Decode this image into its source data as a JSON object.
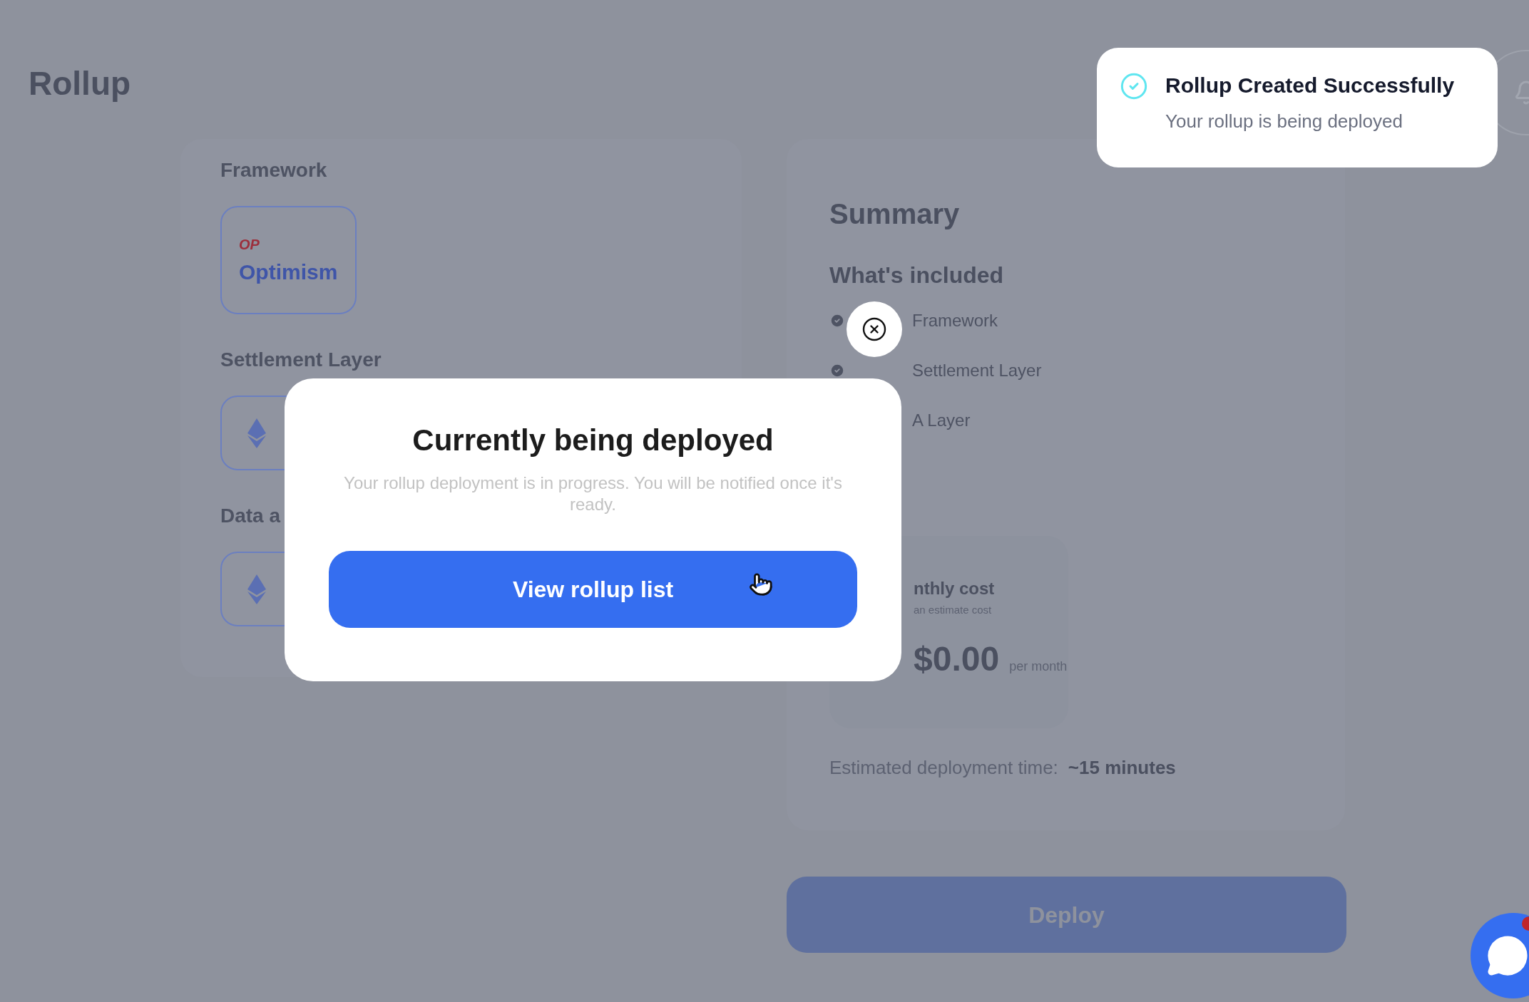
{
  "page": {
    "title": "Rollup"
  },
  "config": {
    "sections": [
      {
        "heading": "Framework",
        "kind": "framework",
        "logo": "OP",
        "label": "Optimism"
      },
      {
        "heading": "Settlement Layer",
        "kind": "chain"
      },
      {
        "heading": "Data a",
        "kind": "chain"
      }
    ]
  },
  "summary": {
    "title": "Summary",
    "included_title": "What's included",
    "items": [
      {
        "label": "Framework"
      },
      {
        "label": "Settlement Layer"
      },
      {
        "label": "A Layer"
      }
    ],
    "cost": {
      "title": "nthly cost",
      "note": "an estimate cost",
      "amount": "$0.00",
      "unit": "per month"
    },
    "eta_label": "Estimated deployment time:",
    "eta_value": "~15 minutes"
  },
  "deploy_button": "Deploy",
  "toast": {
    "title": "Rollup Created Successfully",
    "message": "Your rollup is being deployed"
  },
  "modal": {
    "title": "Currently being deployed",
    "message": "Your rollup deployment is in progress. You will be notified once it's ready.",
    "button": "View rollup list"
  }
}
